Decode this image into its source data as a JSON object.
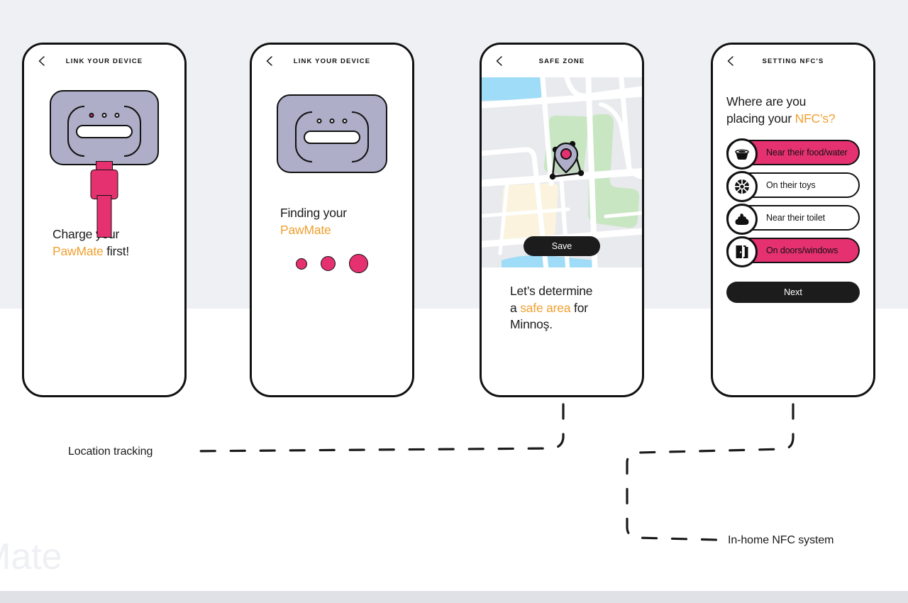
{
  "background": {
    "band_top_color": "#eef0f4",
    "band_bottom_color": "#e0e1e7",
    "watermark_text": "Mate"
  },
  "colors": {
    "accent_pink": "#e5316f",
    "accent_orange": "#f0a030",
    "device_gray": "#aeaec8",
    "ink": "#111111",
    "map_base": "#e8eaed",
    "map_water": "#9edcf7",
    "map_park": "#c8e6c2",
    "map_beige": "#fbf3dd",
    "map_road": "#ffffff"
  },
  "screens": [
    {
      "id": "link-your-device-charge",
      "title": "LINK YOUR DEVICE",
      "back_icon": "chevron-left-icon",
      "caption": {
        "line1": "Charge your",
        "highlight": "PawMate",
        "line2_rest": " first!"
      },
      "device": {
        "dots": [
          "on",
          "off",
          "off"
        ]
      }
    },
    {
      "id": "link-your-device-finding",
      "title": "LINK YOUR DEVICE",
      "back_icon": "chevron-left-icon",
      "caption": {
        "line1": "Finding your",
        "highlight": "PawMate"
      },
      "device": {
        "dots": [
          "off",
          "off",
          "off"
        ]
      },
      "loading_dots": [
        9,
        13,
        17
      ]
    },
    {
      "id": "safe-zone",
      "title": "SAFE ZONE",
      "back_icon": "chevron-left-icon",
      "save_label": "Save",
      "caption": {
        "line1": "Let’s determine",
        "line2_pre": "a ",
        "highlight": "safe area",
        "line2_post": " for",
        "line3": "Minnoş."
      }
    },
    {
      "id": "setting-nfcs",
      "title": "SETTING NFC'S",
      "back_icon": "chevron-left-icon",
      "question": {
        "line1": "Where are you",
        "line2_pre": "placing your ",
        "highlight": "NFC’s?"
      },
      "options": [
        {
          "label": "Near their food/water",
          "icon": "bowl-icon",
          "selected": true
        },
        {
          "label": "On their toys",
          "icon": "ball-icon",
          "selected": false
        },
        {
          "label": "Near their toilet",
          "icon": "poop-icon",
          "selected": false
        },
        {
          "label": "On doors/windows",
          "icon": "door-icon",
          "selected": true
        }
      ],
      "next_label": "Next"
    }
  ],
  "annotations": [
    {
      "id": "location-tracking",
      "label": "Location tracking"
    },
    {
      "id": "in-home-nfc-system",
      "label": "In-home NFC system"
    }
  ]
}
